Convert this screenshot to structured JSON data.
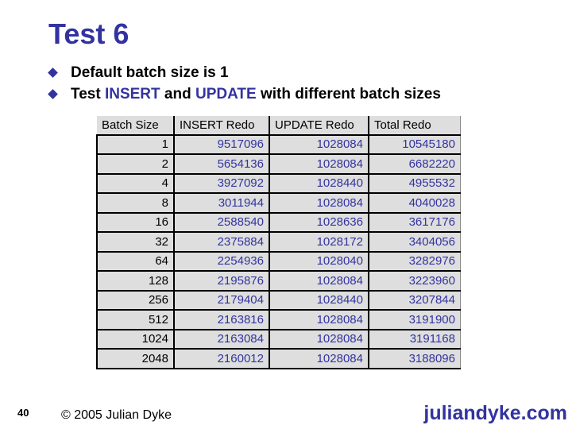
{
  "slide": {
    "title": "Test 6",
    "bullets": [
      {
        "parts": [
          {
            "text": "Default batch size is 1",
            "highlight": false
          }
        ]
      },
      {
        "parts": [
          {
            "text": "Test ",
            "highlight": false
          },
          {
            "text": "INSERT",
            "highlight": true
          },
          {
            "text": " and ",
            "highlight": false
          },
          {
            "text": "UPDATE",
            "highlight": true
          },
          {
            "text": " with different batch sizes",
            "highlight": false
          }
        ]
      }
    ],
    "table": {
      "headers": [
        "Batch Size",
        "INSERT Redo",
        "UPDATE Redo",
        "Total Redo"
      ],
      "rows": [
        [
          "1",
          "9517096",
          "1028084",
          "10545180"
        ],
        [
          "2",
          "5654136",
          "1028084",
          "6682220"
        ],
        [
          "4",
          "3927092",
          "1028440",
          "4955532"
        ],
        [
          "8",
          "3011944",
          "1028084",
          "4040028"
        ],
        [
          "16",
          "2588540",
          "1028636",
          "3617176"
        ],
        [
          "32",
          "2375884",
          "1028172",
          "3404056"
        ],
        [
          "64",
          "2254936",
          "1028040",
          "3282976"
        ],
        [
          "128",
          "2195876",
          "1028084",
          "3223960"
        ],
        [
          "256",
          "2179404",
          "1028440",
          "3207844"
        ],
        [
          "512",
          "2163816",
          "1028084",
          "3191900"
        ],
        [
          "1024",
          "2163084",
          "1028084",
          "3191168"
        ],
        [
          "2048",
          "2160012",
          "1028084",
          "3188096"
        ]
      ]
    },
    "footer": {
      "page_number": "40",
      "copyright": "© 2005 Julian Dyke",
      "site": "juliandyke.com"
    },
    "colors": {
      "accent": "#3333a0",
      "cell_bg": "#dedede"
    }
  }
}
